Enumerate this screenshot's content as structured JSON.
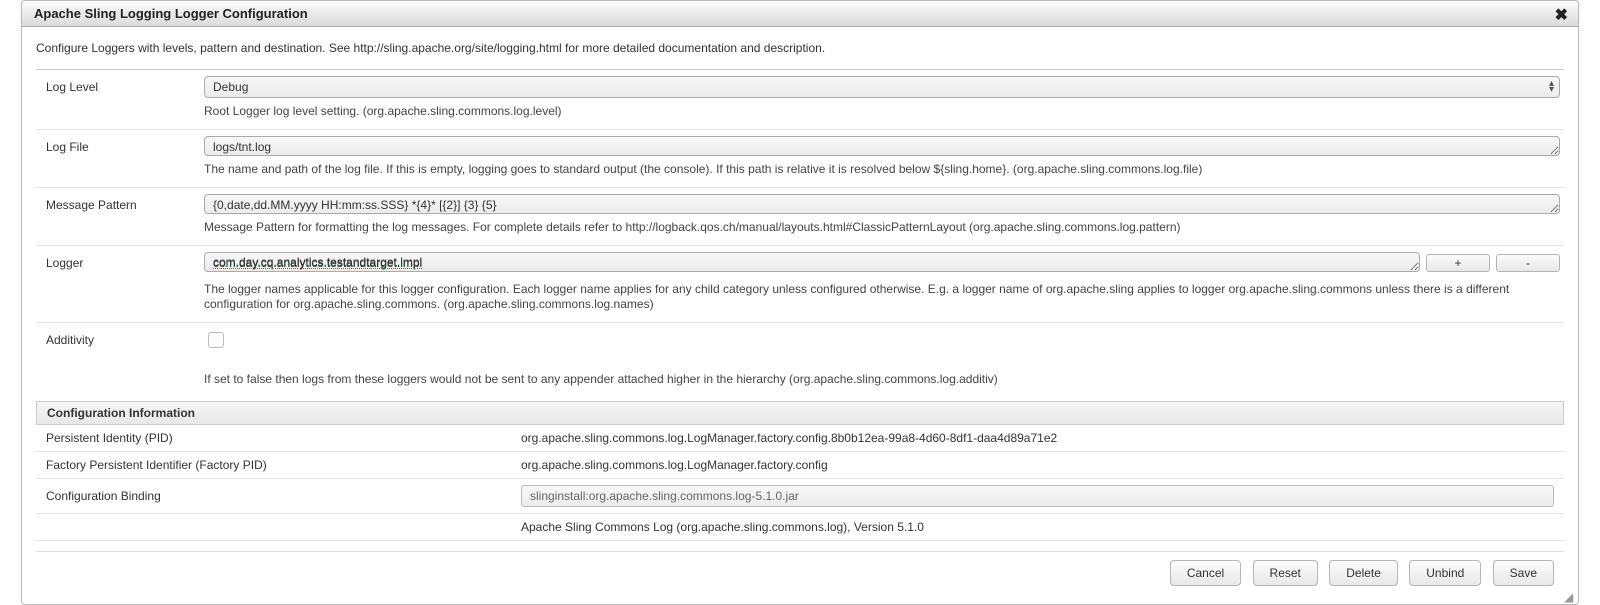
{
  "dialog": {
    "title": "Apache Sling Logging Logger Configuration",
    "description": "Configure Loggers with levels, pattern and destination. See http://sling.apache.org/site/logging.html for more detailed documentation and description."
  },
  "fields": {
    "log_level": {
      "label": "Log Level",
      "value": "Debug",
      "help": "Root Logger log level setting. (org.apache.sling.commons.log.level)"
    },
    "log_file": {
      "label": "Log File",
      "value": "logs/tnt.log",
      "help": "The name and path of the log file. If this is empty, logging goes to standard output (the console). If this path is relative it is resolved below ${sling.home}. (org.apache.sling.commons.log.file)"
    },
    "message_pattern": {
      "label": "Message Pattern",
      "value": "{0,date,dd.MM.yyyy HH:mm:ss.SSS} *{4}* [{2}] {3} {5}",
      "help": "Message Pattern for formatting the log messages. For complete details refer to http://logback.qos.ch/manual/layouts.html#ClassicPatternLayout (org.apache.sling.commons.log.pattern)"
    },
    "logger": {
      "label": "Logger",
      "value": "com.day.cq.analytics.testandtarget.impl",
      "help": "The logger names applicable for this logger configuration. Each logger name applies for any child category unless configured otherwise. E.g. a logger name of org.apache.sling applies to logger org.apache.sling.commons unless there is a different configuration for org.apache.sling.commons. (org.apache.sling.commons.log.names)",
      "add_label": "+",
      "remove_label": "-"
    },
    "additivity": {
      "label": "Additivity",
      "checked": false,
      "help": "If set to false then logs from these loggers would not be sent to any appender attached higher in the hierarchy (org.apache.sling.commons.log.additiv)"
    }
  },
  "config_info": {
    "header": "Configuration Information",
    "pid_label": "Persistent Identity (PID)",
    "pid_value": "org.apache.sling.commons.log.LogManager.factory.config.8b0b12ea-99a8-4d60-8df1-daa4d89a71e2",
    "factory_pid_label": "Factory Persistent Identifier (Factory PID)",
    "factory_pid_value": "org.apache.sling.commons.log.LogManager.factory.config",
    "binding_label": "Configuration Binding",
    "binding_value": "slinginstall:org.apache.sling.commons.log-5.1.0.jar",
    "bundle_info": "Apache Sling Commons Log (org.apache.sling.commons.log), Version 5.1.0"
  },
  "buttons": {
    "cancel": "Cancel",
    "reset": "Reset",
    "delete": "Delete",
    "unbind": "Unbind",
    "save": "Save"
  }
}
